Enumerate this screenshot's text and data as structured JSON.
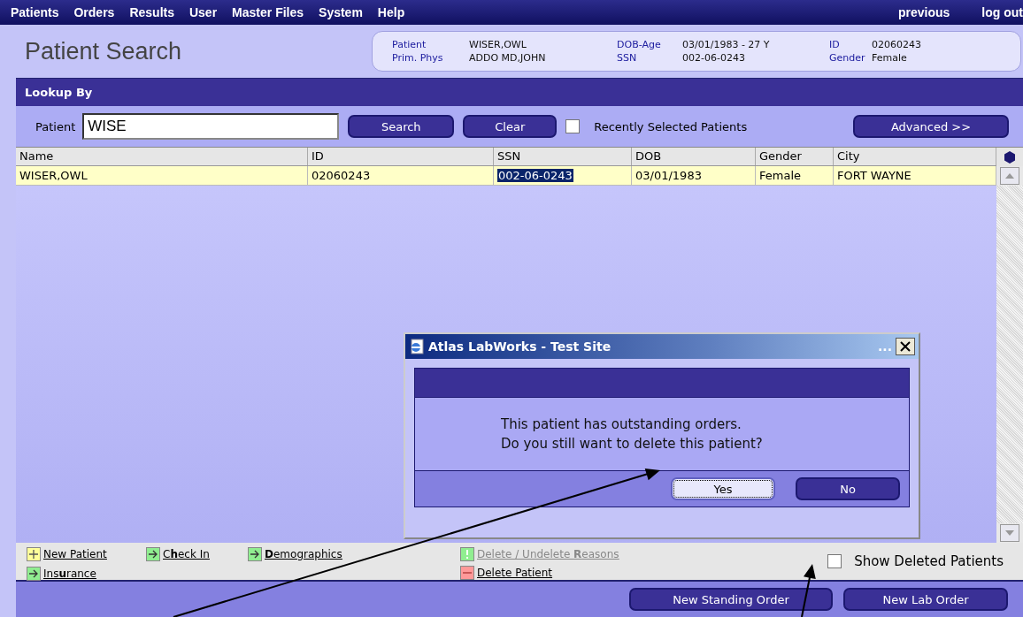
{
  "menu": {
    "items": [
      "Patients",
      "Orders",
      "Results",
      "User",
      "Master Files",
      "System",
      "Help"
    ],
    "right_items": [
      "previous",
      "log out"
    ]
  },
  "header": {
    "title": "Patient Search",
    "patient_info": [
      {
        "label": "Patient",
        "value": "WISER,OWL"
      },
      {
        "label": "Prim. Phys",
        "value": "ADDO MD,JOHN"
      },
      {
        "label": "DOB-Age",
        "value": "03/01/1983 - 27 Y"
      },
      {
        "label": "SSN",
        "value": "002-06-0243"
      },
      {
        "label": "ID",
        "value": "02060243"
      },
      {
        "label": "Gender",
        "value": "Female"
      }
    ]
  },
  "lookup": {
    "title": "Lookup By",
    "field_label": "Patient",
    "field_value": "WISE",
    "buttons": [
      "Search",
      "Clear"
    ],
    "recent_checkbox": {
      "label": "Recently Selected Patients",
      "checked": false
    },
    "advanced_button": "Advanced >>"
  },
  "table": {
    "columns": [
      "Name",
      "ID",
      "SSN",
      "DOB",
      "Gender",
      "City"
    ],
    "rows": [
      {
        "selected": true,
        "cells": [
          {
            "text": "WISER,OWL",
            "highlighted": false
          },
          {
            "text": "02060243",
            "highlighted": false
          },
          {
            "text": "002-06-0243",
            "highlighted": true
          },
          {
            "text": "03/01/1983",
            "highlighted": false
          },
          {
            "text": "Female",
            "highlighted": false
          },
          {
            "text": "FORT WAYNE",
            "highlighted": false
          }
        ]
      }
    ]
  },
  "actions": {
    "left": [
      {
        "label": "New Patient",
        "kind": "add",
        "disabled": false
      },
      {
        "label": "C**h**eck In",
        "kind": "go",
        "disabled": false
      },
      {
        "label": "**D**emographics",
        "kind": "go",
        "disabled": false
      },
      {
        "label": "Ins**u**rance",
        "kind": "go",
        "disabled": false
      }
    ],
    "right": [
      {
        "label": "Delete / Undelete **R**easons",
        "kind": "info",
        "disabled": true
      },
      {
        "label": "Delete Patient",
        "kind": "remove",
        "disabled": false
      }
    ],
    "show_deleted": {
      "label": "Show Deleted Patients",
      "checked": false
    }
  },
  "bottom_buttons": [
    "New Standing Order",
    "New Lab Order"
  ],
  "dialog": {
    "title": "Atlas LabWorks - Test Site",
    "title_extra": "...",
    "message": [
      "This patient has outstanding orders.",
      "Do you still want to delete this patient?"
    ],
    "buttons": [
      {
        "label": "Yes",
        "focused": true
      },
      {
        "label": "No",
        "focused": false
      }
    ]
  }
}
